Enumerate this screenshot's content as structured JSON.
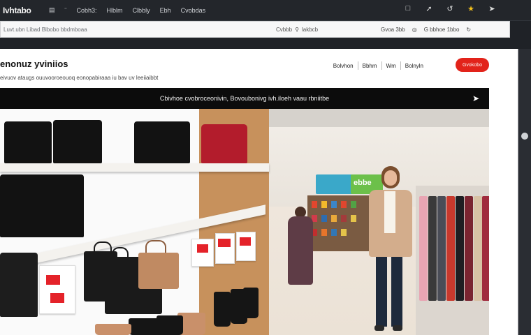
{
  "topbar": {
    "logo": "Ivhtabo",
    "nav": [
      "▤",
      "¨",
      "Cobh3:",
      "Hlblm",
      "Clbbly",
      "Ebh",
      "Cvobdas"
    ],
    "icons": [
      "bookmark-icon",
      "bolt-icon",
      "refresh-icon",
      "star-icon",
      "send-icon"
    ]
  },
  "addressbar": {
    "left_text": "Luvt.ubn Libad Blbobo bbdmboaa",
    "search_label": "Cvbbb",
    "search_value": "lakbcb",
    "right_items": [
      "Gvoa 3bb",
      "G bbhoe 1bbo"
    ]
  },
  "page": {
    "heading": "enonuz yviniios",
    "subheading": "eivuov ataugs ouuvooroeouoq eonopabiraaa iu bav uv leeiiaibbt",
    "navlinks": [
      "Bolvhon",
      "Bbhm",
      "Wm",
      "Bolnyln"
    ],
    "cta_label": "Gvokobo",
    "banner_text": "Cbivhoe cvobroceonivin, Bovoubonivg ivh.iloeh vaau rbniitbe"
  },
  "scene": {
    "sign_text": "ebbe"
  },
  "colors": {
    "accent": "#e2231a",
    "topbar_bg": "#23262b",
    "banner_bg": "#0c0c0c"
  }
}
